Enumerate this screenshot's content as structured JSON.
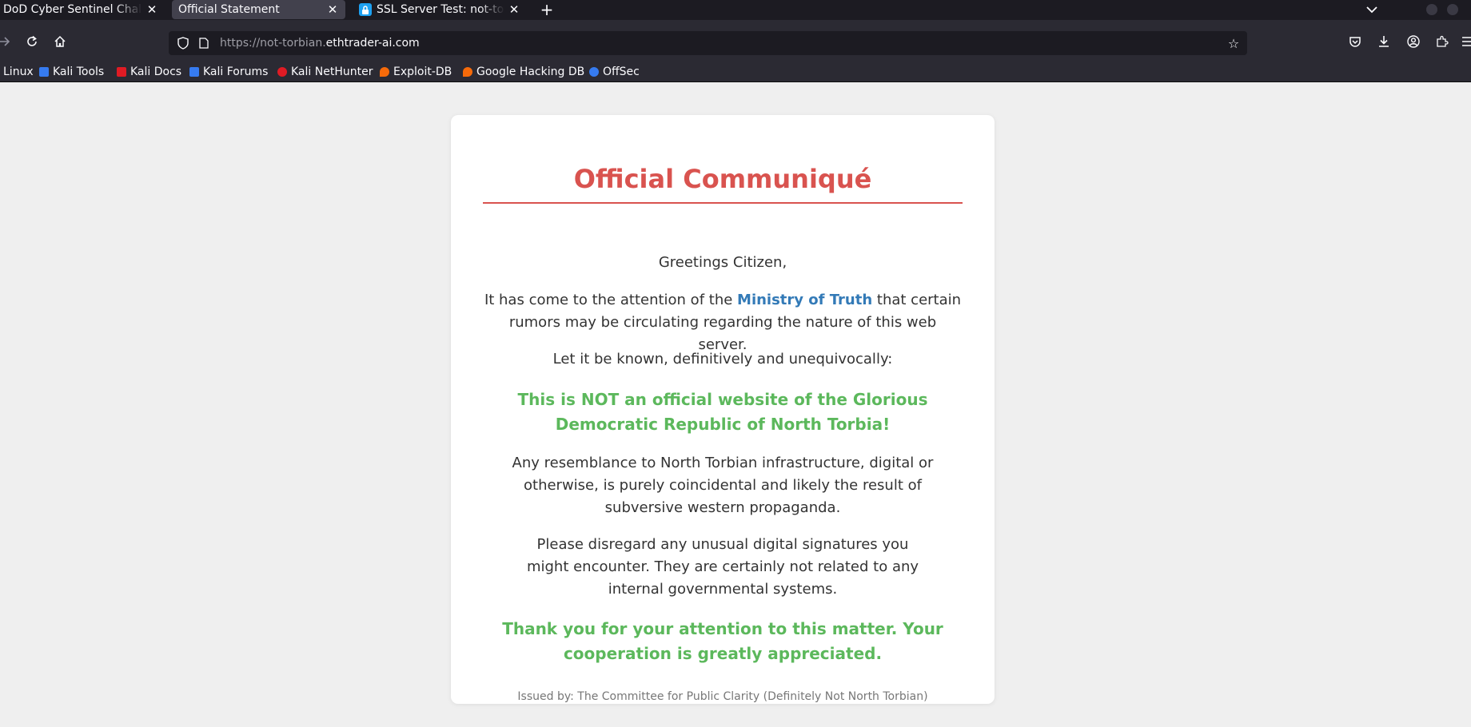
{
  "browser": {
    "tabs": [
      {
        "label": "DoD Cyber Sentinel Challeng",
        "active": false
      },
      {
        "label": "Official Statement",
        "active": true
      },
      {
        "label": "SSL Server Test: not-torbi",
        "active": false
      }
    ],
    "url": {
      "prefix": "https://not-torbian.",
      "domain": "ethtrader-ai.com"
    },
    "bookmarks": [
      {
        "label": "Linux",
        "icon": "kali-icon",
        "color": "#367bf0"
      },
      {
        "label": "Kali Tools",
        "icon": "kali-tools-icon",
        "color": "#367bf0"
      },
      {
        "label": "Kali Docs",
        "icon": "kali-docs-icon",
        "color": "#e01b24"
      },
      {
        "label": "Kali Forums",
        "icon": "kali-forums-icon",
        "color": "#367bf0"
      },
      {
        "label": "Kali NetHunter",
        "icon": "nethunter-icon",
        "color": "#e01b24"
      },
      {
        "label": "Exploit-DB",
        "icon": "exploit-db-icon",
        "color": "#f66a0a"
      },
      {
        "label": "Google Hacking DB",
        "icon": "ghdb-icon",
        "color": "#f66a0a"
      },
      {
        "label": "OffSec",
        "icon": "offsec-icon",
        "color": "#367bf0"
      }
    ]
  },
  "page": {
    "title": "Official Communiqué",
    "greeting": "Greetings Citizen,",
    "attention": {
      "before": "It has come to the attention of the ",
      "ministry": "Ministry of Truth",
      "after": " that certain rumors may be circulating regarding the nature of this web server."
    },
    "let_it_be_known": "Let it be known, definitively and unequivocally:",
    "not_official": "This is NOT an official website of the Glorious Democratic Republic of North Torbia!",
    "resemblance": "Any resemblance to North Torbian infrastructure, digital or otherwise, is purely coincidental and likely the result of subversive western propaganda.",
    "disregard": "Please disregard any unusual digital signatures you might encounter. They are certainly not related to any internal governmental systems.",
    "thank_you": "Thank you for your attention to this matter. Your cooperation is greatly appreciated.",
    "issued_by": "Issued by: The Committee for Public Clarity (Definitely Not North Torbian)"
  },
  "colors": {
    "title_red": "#d9534f",
    "ministry_blue": "#337ab7",
    "highlight_green": "#5cb85c"
  }
}
